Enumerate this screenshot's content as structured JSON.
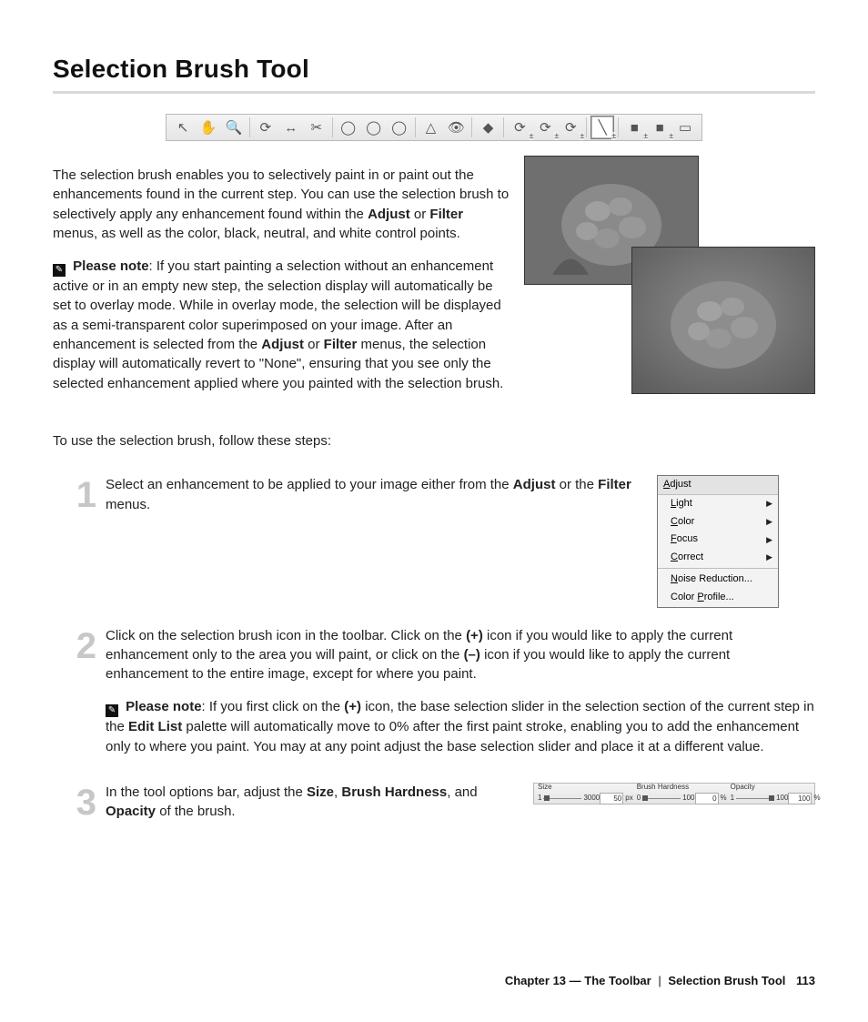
{
  "title": "Selection Brush Tool",
  "toolbar": {
    "icons": [
      "↖",
      "✋",
      "🔍",
      "⟳",
      "↔",
      "✂",
      "◯",
      "◯",
      "◯",
      "△",
      "👁",
      "◆",
      "⟳",
      "⟳",
      "⟳",
      "╲",
      "■",
      "■",
      "▭"
    ],
    "selected_index": 15
  },
  "intro": {
    "p1a": "The selection brush enables you to selectively paint in or paint out the enhancements found in the current step. You can use the selection brush to selectively apply any enhancement found within the ",
    "adjust": "Adjust",
    "p1b": " or ",
    "filter": "Filter",
    "p1c": " menus, as well as the color, black, neutral, and white control points.",
    "note_label": "Please note",
    "note_a": ": If you start painting a selection without an enhancement active or in an empty new step, the selection display will automatically be set to overlay mode. While in overlay mode, the selection will be displayed as a semi-transparent color superimposed on your image. After an enhancement is selected from the ",
    "note_b": " menus, the selection display will automatically revert to \"None\", ensuring that you see only the selected enhancement applied where you painted with the selection brush.",
    "lead": "To use the selection brush, follow these steps:"
  },
  "menu": {
    "title_u": "A",
    "title_rest": "djust",
    "items": [
      {
        "u": "L",
        "rest": "ight",
        "arrow": true
      },
      {
        "u": "C",
        "rest": "olor",
        "arrow": true
      },
      {
        "u": "F",
        "rest": "ocus",
        "arrow": true
      },
      {
        "u": "C",
        "rest": "orrect",
        "arrow": true
      }
    ],
    "items2": [
      {
        "u": "N",
        "rest": "oise Reduction...",
        "arrow": false
      },
      {
        "pre": "Color ",
        "u": "P",
        "rest": "rofile...",
        "arrow": false
      }
    ]
  },
  "steps": {
    "s1_num": "1",
    "s1a": "Select an enhancement to be applied to your image either from the ",
    "s1b": " or the ",
    "s1c": " menus.",
    "s2_num": "2",
    "s2a": "Click on the selection brush icon in the toolbar. Click on the ",
    "plus": "(+)",
    "s2b": " icon if you would like to apply the current enhancement only to the area you will paint, or click on the ",
    "minus": "(–)",
    "s2c": " icon if you would like to apply the current enhancement to the entire image, except for where you paint.",
    "s2_note_a": ": If you first click on the ",
    "s2_note_b": " icon, the base selection slider in the selection section of the current step in the ",
    "edit_list": "Edit List",
    "s2_note_c": " palette will automatically move to 0% after the first paint stroke, enabling you to add the enhancement only to where you paint. You may at any point adjust the base selection slider and place it at a different value.",
    "s3_num": "3",
    "s3a": "In the tool options bar, adjust the ",
    "size": "Size",
    "s3b": ", ",
    "hardness": "Brush Hardness",
    "s3c": ", and ",
    "opacity": "Opacity",
    "s3d": " of the brush."
  },
  "options": {
    "size_label": "Size",
    "size_min": "1",
    "size_max": "3000",
    "size_val": "50",
    "size_unit": "px",
    "hard_label": "Brush Hardness",
    "hard_min": "0",
    "hard_max": "100",
    "hard_val": "0",
    "hard_unit": "%",
    "opac_label": "Opacity",
    "opac_min": "1",
    "opac_max": "100",
    "opac_val": "100",
    "opac_unit": "%"
  },
  "footer": {
    "chapter": "Chapter 13 — The Toolbar",
    "section": "Selection Brush Tool",
    "page": "113"
  }
}
